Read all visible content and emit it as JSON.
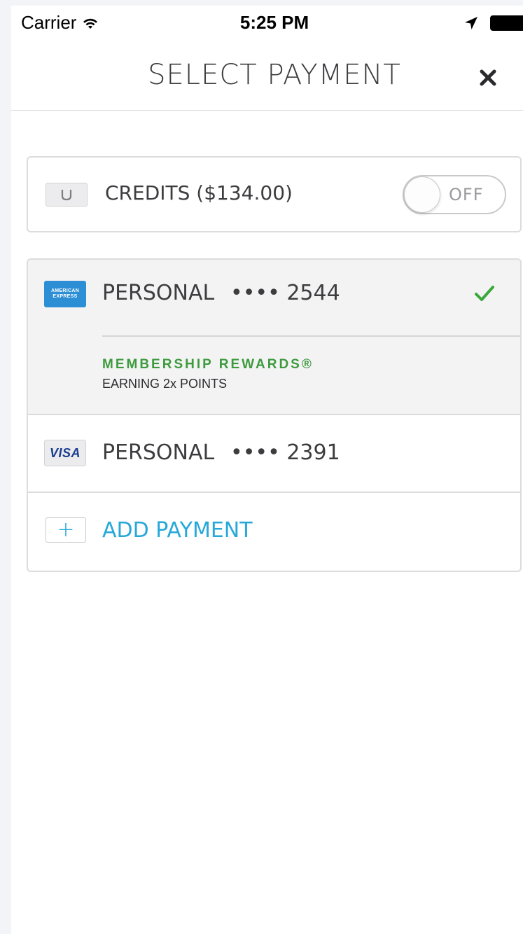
{
  "status_bar": {
    "carrier": "Carrier",
    "time": "5:25 PM",
    "icons": [
      "wifi-icon",
      "location-arrow-icon",
      "battery-icon"
    ]
  },
  "header": {
    "title": "SELECT PAYMENT",
    "close_icon": "close-icon"
  },
  "credits": {
    "icon": "uber-credit-icon",
    "label": "CREDITS ($134.00)",
    "toggle_state": "OFF"
  },
  "payment_methods": [
    {
      "brand": "amex",
      "logo_text_line1": "AMERICAN",
      "logo_text_line2": "EXPRESS",
      "name": "PERSONAL",
      "number": "•••• 2544",
      "selected": true,
      "rewards_title": "MEMBERSHIP REWARDS®",
      "rewards_sub": "EARNING 2x POINTS"
    },
    {
      "brand": "visa",
      "logo_text": "VISA",
      "name": "PERSONAL",
      "number": "•••• 2391",
      "selected": false
    }
  ],
  "add_payment": {
    "icon_text": "+",
    "label": "ADD PAYMENT"
  },
  "colors": {
    "accent": "#27a8d8",
    "rewards_green": "#3d9a3d",
    "check_green": "#3aa83a",
    "amex_blue": "#2c8fd6"
  }
}
